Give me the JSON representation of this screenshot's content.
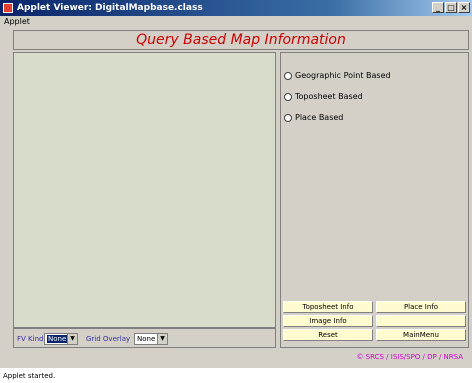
{
  "window": {
    "title": "Applet Viewer: DigitalMapbase.class",
    "controls": {
      "minimize": "_",
      "maximize": "□",
      "close": "×"
    }
  },
  "menubar": {
    "items": [
      "Applet"
    ]
  },
  "header": {
    "title": "Query Based Map Information"
  },
  "query_options": [
    {
      "label": "Geographic Point Based",
      "selected": false
    },
    {
      "label": "Toposheet Based",
      "selected": false
    },
    {
      "label": "Place Based",
      "selected": false
    }
  ],
  "buttons": {
    "toposheet_info": "Toposheet Info",
    "place_info": "Place Info",
    "image_info": "Image Info",
    "blank": "",
    "reset": "Reset",
    "main_menu": "MainMenu"
  },
  "bottom_controls": {
    "fv_label": "FV Kind",
    "fv_value": "None",
    "grid_overlay_label": "Grid Overlay",
    "grid_overlay_value": "None"
  },
  "credit": "© SRCS / ISIS/SPO / DP / NRSA",
  "status": "Applet started.",
  "colors": {
    "title_red": "#cc0000",
    "map_bg": "#d8ddcb",
    "button_bg": "#fffbd0",
    "credit_magenta": "#cc00cc"
  }
}
